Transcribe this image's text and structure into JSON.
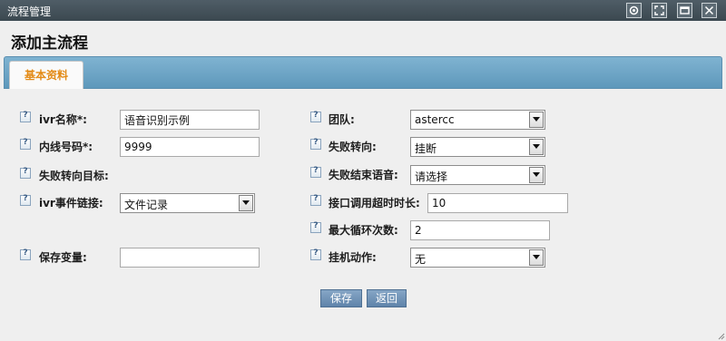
{
  "window": {
    "title": "流程管理"
  },
  "page": {
    "heading": "添加主流程"
  },
  "tabs": [
    {
      "label": "基本资料"
    }
  ],
  "form": {
    "ivr_name": {
      "label": "ivr名称*:",
      "value": "语音识别示例"
    },
    "extension": {
      "label": "内线号码*:",
      "value": "9999"
    },
    "fail_target": {
      "label": "失败转向目标:"
    },
    "ivr_event_link": {
      "label": "ivr事件链接:",
      "value": "文件记录"
    },
    "save_variable": {
      "label": "保存变量:",
      "value": ""
    },
    "team": {
      "label": "团队:",
      "value": "astercc"
    },
    "fail_redirect": {
      "label": "失败转向:",
      "value": "挂断"
    },
    "fail_end_voice": {
      "label": "失败结束语音:",
      "value": "请选择"
    },
    "api_timeout": {
      "label": "接口调用超时时长:",
      "value": "10"
    },
    "max_loops": {
      "label": "最大循环次数:",
      "value": "2"
    },
    "hangup_action": {
      "label": "挂机动作:",
      "value": "无"
    }
  },
  "buttons": {
    "save": "保存",
    "back": "返回"
  },
  "help_glyph": "?"
}
